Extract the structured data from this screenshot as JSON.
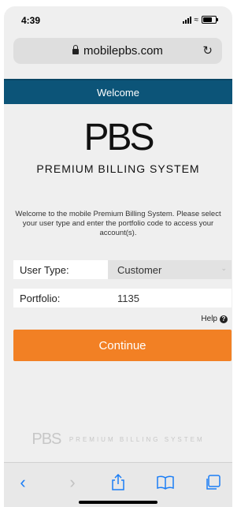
{
  "status_bar": {
    "time": "4:39"
  },
  "browser": {
    "domain": "mobilepbs.com"
  },
  "header": {
    "title": "Welcome"
  },
  "logo": {
    "text": "PBS",
    "tagline": "PREMIUM BILLING SYSTEM"
  },
  "intro": "Welcome to the mobile Premium Billing System. Please select your user type and enter the portfolio code to access your account(s).",
  "form": {
    "user_type_label": "User Type:",
    "user_type_value": "Customer",
    "portfolio_label": "Portfolio:",
    "portfolio_value": "1135",
    "help_label": "Help"
  },
  "continue_label": "Continue",
  "footer": {
    "logo_text": "PBS",
    "tagline": "PREMIUM BILLING SYSTEM"
  },
  "colors": {
    "header": "#0c5478",
    "button": "#f28024",
    "link": "#1b7ef6"
  }
}
